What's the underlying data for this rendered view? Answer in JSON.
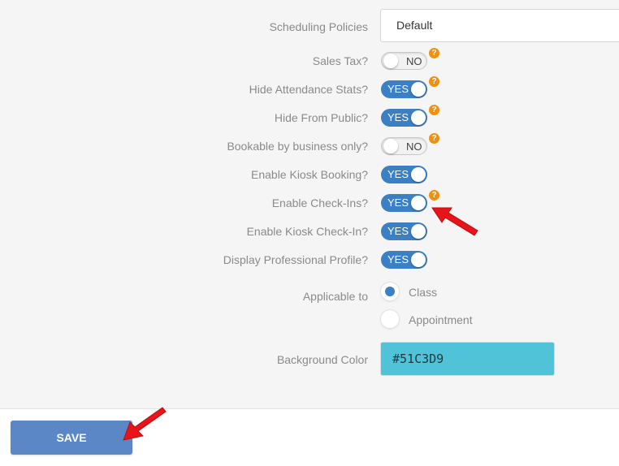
{
  "form": {
    "scheduling_policies": {
      "label": "Scheduling Policies",
      "value": "Default"
    },
    "sales_tax": {
      "label": "Sales Tax?",
      "state": "NO",
      "help": "?"
    },
    "hide_attendance_stats": {
      "label": "Hide Attendance Stats?",
      "state": "YES",
      "help": "?"
    },
    "hide_from_public": {
      "label": "Hide From Public?",
      "state": "YES",
      "help": "?"
    },
    "bookable_by_business_only": {
      "label": "Bookable by business only?",
      "state": "NO",
      "help": "?"
    },
    "enable_kiosk_booking": {
      "label": "Enable Kiosk Booking?",
      "state": "YES"
    },
    "enable_check_ins": {
      "label": "Enable Check-Ins?",
      "state": "YES",
      "help": "?"
    },
    "enable_kiosk_check_in": {
      "label": "Enable Kiosk Check-In?",
      "state": "YES"
    },
    "display_professional_profile": {
      "label": "Display Professional Profile?",
      "state": "YES"
    },
    "applicable_to": {
      "label": "Applicable to",
      "options": [
        "Class",
        "Appointment"
      ],
      "selected": "Class"
    },
    "background_color": {
      "label": "Background Color",
      "value": "#51C3D9"
    }
  },
  "footer": {
    "save_label": "SAVE"
  },
  "colors": {
    "toggle_on": "#3b7fc4",
    "help_badge": "#f0900c",
    "save_button": "#5b87c7",
    "annotation_arrow": "#e8141a"
  }
}
